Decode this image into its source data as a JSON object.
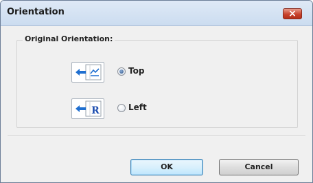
{
  "window": {
    "title": "Orientation",
    "close_glyph": "×"
  },
  "group": {
    "label": "Original Orientation:"
  },
  "options": [
    {
      "label": "Top",
      "selected": true,
      "icon": "orientation-top-icon"
    },
    {
      "label": "Left",
      "selected": false,
      "icon": "orientation-left-icon"
    }
  ],
  "icon_glyphs": {
    "left_letter": "R"
  },
  "buttons": {
    "ok": "OK",
    "cancel": "Cancel"
  },
  "colors": {
    "titlebar": "#cbdcf0",
    "close_button": "#c8422c",
    "default_button_border": "#3c7fb1",
    "arrow_blue": "#1f6fd0"
  }
}
